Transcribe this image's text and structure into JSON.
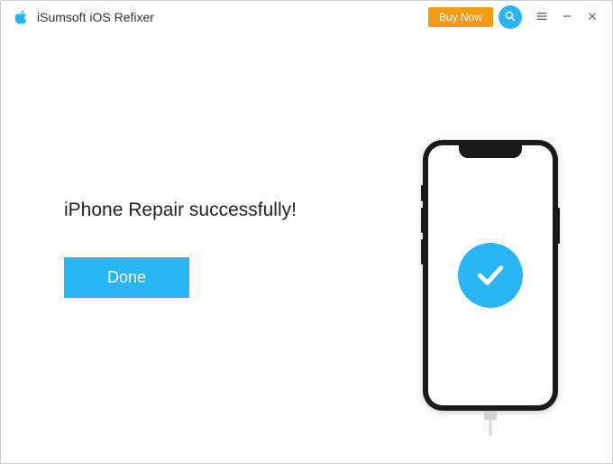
{
  "titlebar": {
    "app_title": "iSumsoft iOS Refixer",
    "buy_now_label": "Buy Now"
  },
  "content": {
    "message": "iPhone Repair successfully!",
    "done_label": "Done"
  },
  "colors": {
    "accent": "#29b6f6",
    "buy_now": "#f39c12"
  }
}
